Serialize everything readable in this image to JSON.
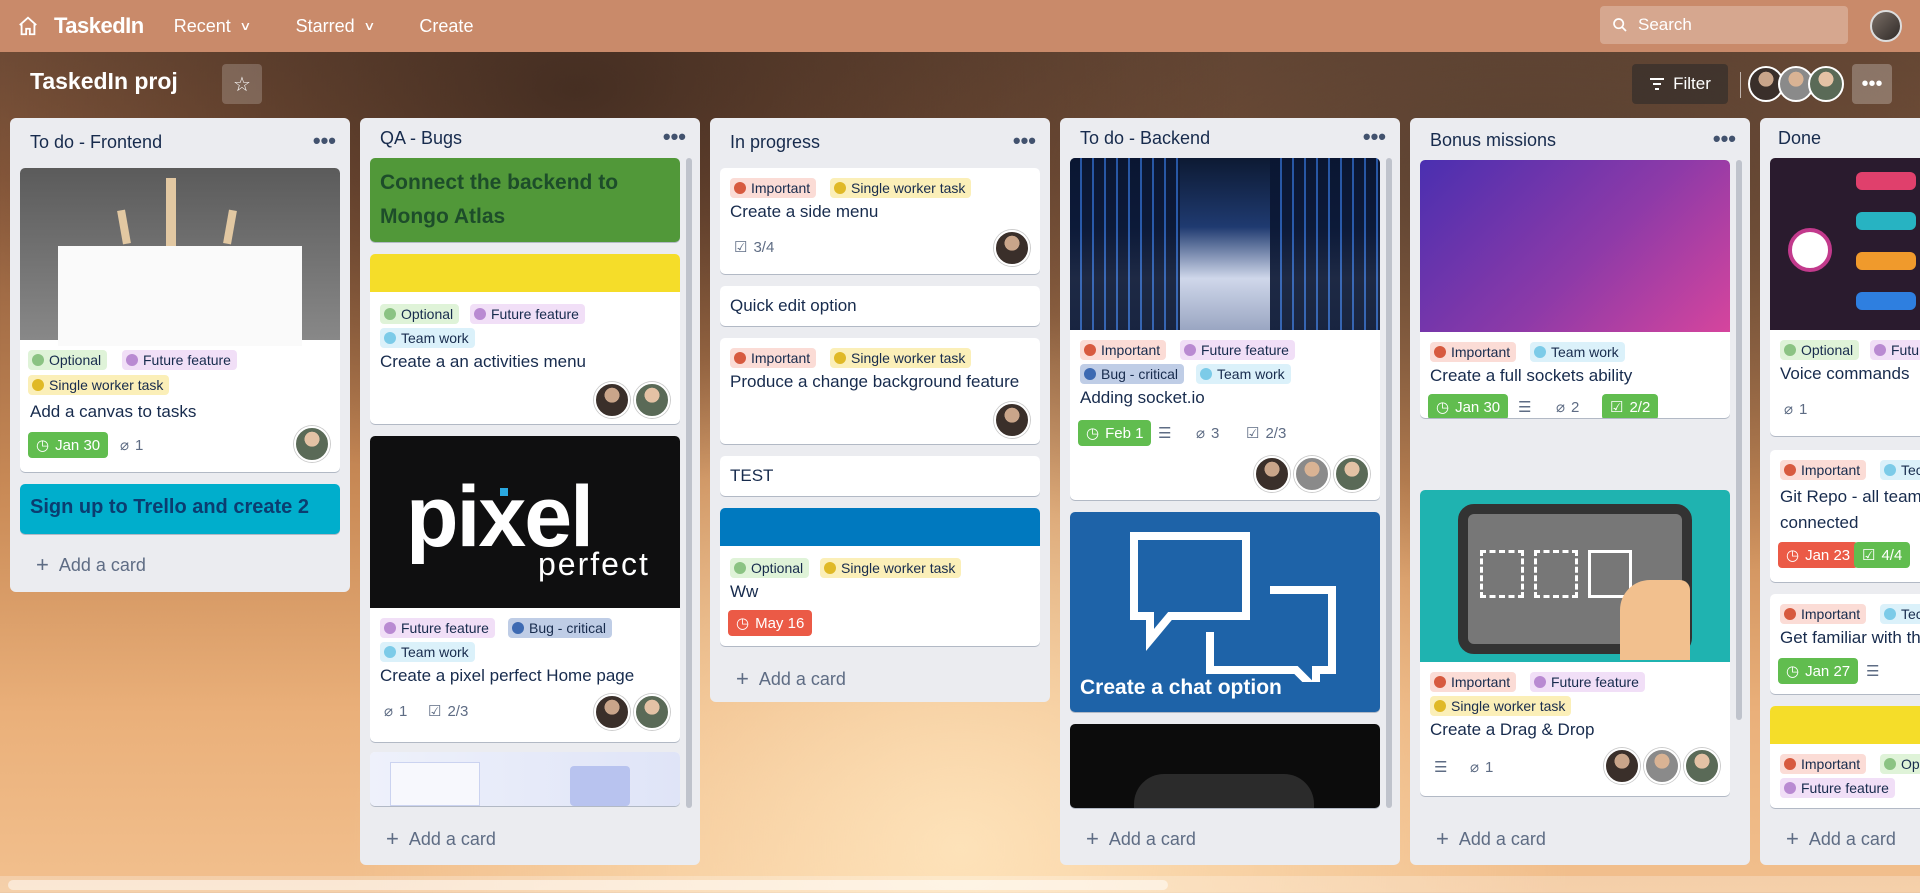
{
  "nav": {
    "app_name": "TaskedIn",
    "recent": "Recent",
    "starred": "Starred",
    "create": "Create",
    "search_placeholder": "Search"
  },
  "board": {
    "title": "TaskedIn proj",
    "filter": "Filter"
  },
  "add_card": "Add a card",
  "labels": {
    "optional": "Optional",
    "future": "Future feature",
    "single": "Single worker task",
    "team": "Team work",
    "important": "Important",
    "bug": "Bug - critical"
  },
  "lists": {
    "frontend": {
      "title": "To do - Frontend",
      "card1": {
        "title": "Add a canvas to tasks",
        "date": "Jan 30",
        "attachments": "1"
      },
      "card2": {
        "title": "Sign up to Trello and create 2"
      }
    },
    "qa": {
      "title": "QA - Bugs",
      "card1": {
        "title": "Connect the backend to Mongo Atlas"
      },
      "card2": {
        "title": "Create a an activities menu"
      },
      "card3": {
        "title": "Create a pixel perfect Home page",
        "cover_text_1": "pixel",
        "cover_text_2": "perfect",
        "attachments": "1",
        "checklist": "2/3"
      }
    },
    "progress": {
      "title": "In progress",
      "card1": {
        "title": "Create a side menu",
        "checklist": "3/4"
      },
      "card2": {
        "title": "Quick edit option"
      },
      "card3": {
        "title": "Produce a change background feature"
      },
      "card4": {
        "title": "TEST"
      },
      "card5": {
        "title": "Ww",
        "date": "May 16"
      }
    },
    "backend": {
      "title": "To do - Backend",
      "card1": {
        "title": "Adding socket.io",
        "date": "Feb 1",
        "attachments": "3",
        "checklist": "2/3"
      },
      "card2": {
        "title": "Create a chat option"
      }
    },
    "bonus": {
      "title": "Bonus missions",
      "card1": {
        "title": "Create a full sockets ability",
        "date": "Jan 30",
        "attachments": "2",
        "checklist": "2/2"
      },
      "card2": {
        "title": "Create a Drag & Drop",
        "attachments": "1"
      }
    },
    "done": {
      "title": "Done",
      "card1": {
        "title": "Voice commands",
        "attachments": "1",
        "label2": "Futu"
      },
      "card2": {
        "title": "Git Repo - all team connected",
        "date": "Jan 23",
        "checklist": "4/4",
        "label2": "Tec"
      },
      "card3": {
        "title": "Get familiar with th",
        "date": "Jan 27",
        "label2": "Tec"
      },
      "card4": {
        "label2": "Op"
      }
    }
  },
  "colors": {
    "green_date": "#61bd4f",
    "red_date": "#eb5a46",
    "list_bg": "#ebecf0",
    "top_nav": "#c98a6a"
  }
}
